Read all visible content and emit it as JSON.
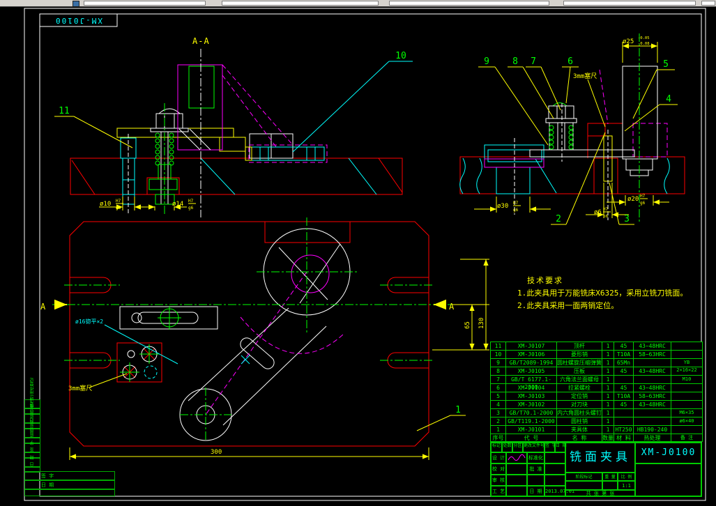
{
  "frame": {
    "corner_code": "XM-J0100",
    "side_labels": [
      "借(通)用件登记",
      "旧底图总号",
      "底图总号",
      "签 字",
      "日 期"
    ],
    "bottom_left_labels": [
      "签 字",
      "日 期"
    ]
  },
  "views": {
    "section_label": "A-A",
    "cut_arrow": "A",
    "balloons": {
      "b1": "1",
      "b2": "2",
      "b3": "3",
      "b4": "4",
      "b5": "5",
      "b6": "6",
      "b7": "7",
      "b8": "8",
      "b9": "9",
      "b10": "10",
      "b11": "11"
    },
    "notes": {
      "feeler": "3mm塞尺",
      "hole_note": "ø16锪平×2"
    },
    "dims": {
      "d300": "300",
      "d65": "65",
      "d130": "130",
      "phi10": "ø10",
      "phi14": "ø14",
      "phi30": "ø30",
      "phi6": "ø6",
      "phi20": "ø20",
      "phi25": "ø25",
      "fit_H7": "H7",
      "fit_g6": "g6",
      "fit_n6": "n6",
      "tol_up": "-0.05",
      "tol_dn": "-0.08"
    }
  },
  "tech_req": {
    "title": "技术要求",
    "items": [
      "1.此夹具用于万能铣床X6325，采用立铣刀铣面。",
      "2.此夹具采用一面两销定位。"
    ]
  },
  "parts_table": {
    "headers": [
      "序号",
      "代  号",
      "名  称",
      "数量",
      "材 料",
      "热处理",
      "备  注"
    ],
    "rows": [
      [
        "11",
        "XM-J0107",
        "顶杆",
        "1",
        "45",
        "43~48HRC",
        ""
      ],
      [
        "10",
        "XM-J0106",
        "菱形销",
        "1",
        "T10A",
        "58~63HRC",
        ""
      ],
      [
        "9",
        "GB/T2089-1994",
        "圆柱螺旋压缩弹簧",
        "1",
        "65Mn",
        "",
        "YB\n2×16×22"
      ],
      [
        "8",
        "XM-J0105",
        "压板",
        "1",
        "45",
        "43~48HRC",
        ""
      ],
      [
        "7",
        "GB/T 6177.1-2000",
        "六角法兰面螺母",
        "1",
        "",
        "",
        "M10"
      ],
      [
        "6",
        "XM-J0104",
        "拉紧螺栓",
        "1",
        "45",
        "43~48HRC",
        ""
      ],
      [
        "5",
        "XM-J0103",
        "定位销",
        "1",
        "T10A",
        "58~63HRC",
        ""
      ],
      [
        "4",
        "XM-J0102",
        "对刀块",
        "1",
        "45",
        "43~48HRC",
        ""
      ],
      [
        "3",
        "GB/T70.1-2000",
        "内六角圆柱头螺钉",
        "1",
        "",
        "",
        "M6×35"
      ],
      [
        "2",
        "GB/T119.1-2000",
        "圆柱销",
        "1",
        "",
        "",
        "ø6×40"
      ],
      [
        "1",
        "XM-J0101",
        "夹具体",
        "1",
        "HT250",
        "HB190-240",
        ""
      ]
    ]
  },
  "title_block": {
    "part_name": "铣面夹具",
    "drawing_no": "XM-J0100",
    "change_row": [
      "标记",
      "处数",
      "分区",
      "更改文件号",
      "签 字",
      "日 期"
    ],
    "left_labels": [
      "设 计",
      "校 对",
      "审 核",
      "工 艺"
    ],
    "col3_labels": [
      "标准化",
      "批 准",
      "",
      "日 期"
    ],
    "stage_label": "阶段标记",
    "weight_label": "重 量",
    "scale_label": "比 例",
    "scale_value": "1:1",
    "sheet_note": "共  张  第  张",
    "date": "2013.07.01"
  }
}
